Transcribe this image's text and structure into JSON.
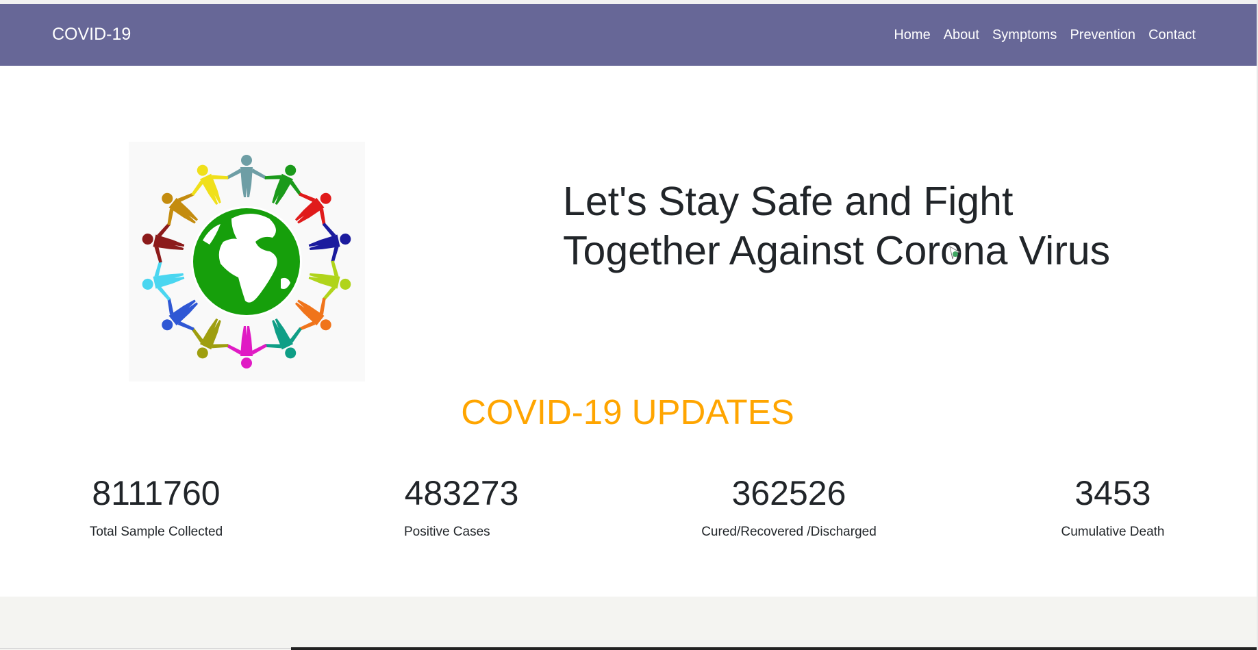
{
  "nav": {
    "brand": "COVID-19",
    "links": [
      "Home",
      "About",
      "Symptoms",
      "Prevention",
      "Contact"
    ]
  },
  "hero": {
    "image_icon": "people-around-globe-icon",
    "title_line1": "Let's Stay Safe and Fight",
    "title_line2": "Together Against Corona Virus"
  },
  "updates": {
    "title": "COVID-19 UPDATES",
    "stats": [
      {
        "value": "8111760",
        "label": "Total Sample Collected"
      },
      {
        "value": "483273",
        "label": "Positive Cases"
      },
      {
        "value": "362526",
        "label": "Cured/Recovered /Discharged"
      },
      {
        "value": "3453",
        "label": "Cumulative Death"
      }
    ]
  },
  "colors": {
    "navbar": "#676797",
    "accent": "#ffa500",
    "footer": "#f4f4f1"
  }
}
